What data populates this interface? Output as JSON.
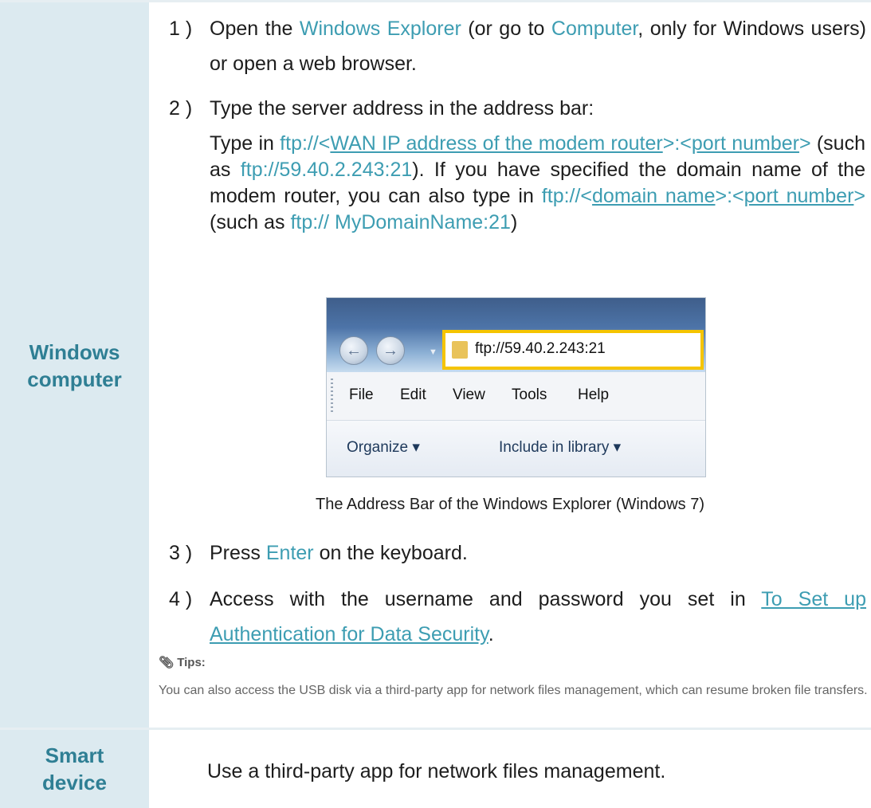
{
  "rows": {
    "windows_label": [
      "Windows",
      "computer"
    ],
    "smart_label": [
      "Smart",
      "device"
    ]
  },
  "steps": {
    "s1": {
      "num": "1 )",
      "t1": "Open the ",
      "link1": "Windows Explorer",
      "t2": " (or go to ",
      "link2": "Computer",
      "t3": ", only for Windows users) or open a web browser."
    },
    "s2": {
      "num": "2 )",
      "text": "Type the server address in the address bar:",
      "p_type_in": "Type in ",
      "ftp1_pre": "ftp://<",
      "ftp1_u": "WAN IP address of the modem router",
      "ftp1_mid": ">:<",
      "ftp1_u2": "port number",
      "ftp1_post": ">",
      "p_such1": " (such as ",
      "example1": "ftp://59.40.2.243:21",
      "p_rest1": "). If you have specified the domain name of the modem router, you can also type in ",
      "ftp2_pre": "ftp://<",
      "ftp2_u": "domain name",
      "ftp2_mid": ">:<",
      "ftp2_u2": "port number",
      "ftp2_post": ">",
      "p_such2": " (such as ",
      "example2": "ftp:// MyDomainName:21",
      "p_end": ")"
    },
    "s3": {
      "num": "3 )",
      "t1": "Press ",
      "link": "Enter",
      "t2": " on the keyboard."
    },
    "s4": {
      "num": "4 )",
      "t1": "Access with the username and password you set in ",
      "link": "To Set up Authentication for Data Security",
      "t2": "."
    }
  },
  "explorer": {
    "address": "ftp://59.40.2.243:21",
    "menu": [
      "File",
      "Edit",
      "View",
      "Tools",
      "Help"
    ],
    "organize": "Organize ▾",
    "include": "Include in library ▾"
  },
  "caption": "The Address Bar of the Windows Explorer (Windows 7)",
  "tips": {
    "title": "Tips:",
    "text": "You can also access the USB disk via a third-party app for network files management, which can resume broken file transfers."
  },
  "smart_text": "Use a third-party app for network files management."
}
